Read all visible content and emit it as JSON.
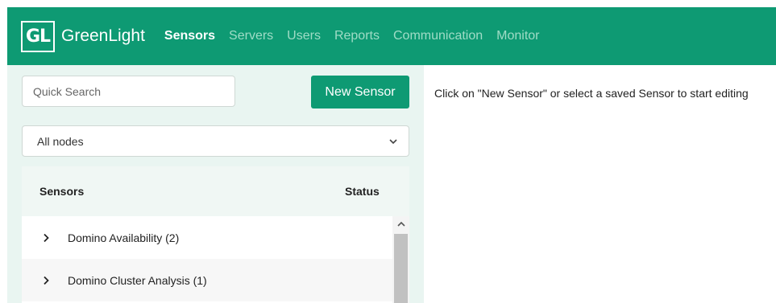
{
  "header": {
    "logo_text": "GL",
    "brand": "GreenLight",
    "nav": [
      {
        "label": "Sensors",
        "active": true
      },
      {
        "label": "Servers",
        "active": false
      },
      {
        "label": "Users",
        "active": false
      },
      {
        "label": "Reports",
        "active": false
      },
      {
        "label": "Communication",
        "active": false
      },
      {
        "label": "Monitor",
        "active": false
      }
    ]
  },
  "sidebar": {
    "search": {
      "placeholder": "Quick Search",
      "value": ""
    },
    "new_button_label": "New Sensor",
    "node_filter": {
      "selected": "All nodes",
      "icon": "chevron-down-icon"
    },
    "table": {
      "columns": [
        "Sensors",
        "Status"
      ],
      "rows": [
        {
          "label": "Domino Availability (2)",
          "icon": "chevron-right-icon"
        },
        {
          "label": "Domino Cluster Analysis (1)",
          "icon": "chevron-right-icon"
        }
      ]
    }
  },
  "main": {
    "hint": "Click on \"New Sensor\" or select a saved Sensor to start editing"
  },
  "colors": {
    "brand_green": "#0e9a73",
    "nav_inactive": "#9fdcc6",
    "panel_bg": "#e9f5f1"
  }
}
